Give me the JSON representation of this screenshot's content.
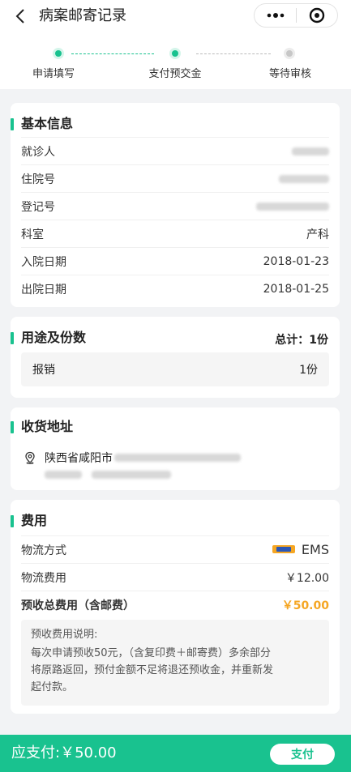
{
  "nav": {
    "title": "病案邮寄记录"
  },
  "steps": [
    {
      "label": "申请填写",
      "state": "done"
    },
    {
      "label": "支付预交金",
      "state": "done"
    },
    {
      "label": "等待审核",
      "state": "pending"
    }
  ],
  "basic": {
    "title": "基本信息",
    "rows": [
      {
        "label": "就诊人",
        "value": ""
      },
      {
        "label": "住院号",
        "value": ""
      },
      {
        "label": "登记号",
        "value": ""
      },
      {
        "label": "科室",
        "value": "产科"
      },
      {
        "label": "入院日期",
        "value": "2018-01-23"
      },
      {
        "label": "出院日期",
        "value": "2018-01-25"
      }
    ]
  },
  "usage": {
    "title": "用途及份数",
    "total": "总计：1份",
    "item_label": "报销",
    "item_count": "1份"
  },
  "address": {
    "title": "收货地址",
    "text": "陕西省咸阳市"
  },
  "fee": {
    "title": "费用",
    "method_label": "物流方式",
    "method_value": "EMS",
    "shipping_label": "物流费用",
    "shipping_value": "￥12.00",
    "prepay_label": "预收总费用（含邮费）",
    "prepay_value": "￥50.00",
    "note_head": "预收费用说明:",
    "note_line1": "每次申请预收50元，（含复印费＋邮寄费）多余部分",
    "note_line2": "将原路返回，预付金额不足将退还预收金，并重新发",
    "note_line3": "起付款。"
  },
  "bottom": {
    "due": "应支付:￥50.00",
    "pay_label": "支付"
  },
  "colors": {
    "accent": "#19c28f",
    "orange": "#f5a623"
  }
}
